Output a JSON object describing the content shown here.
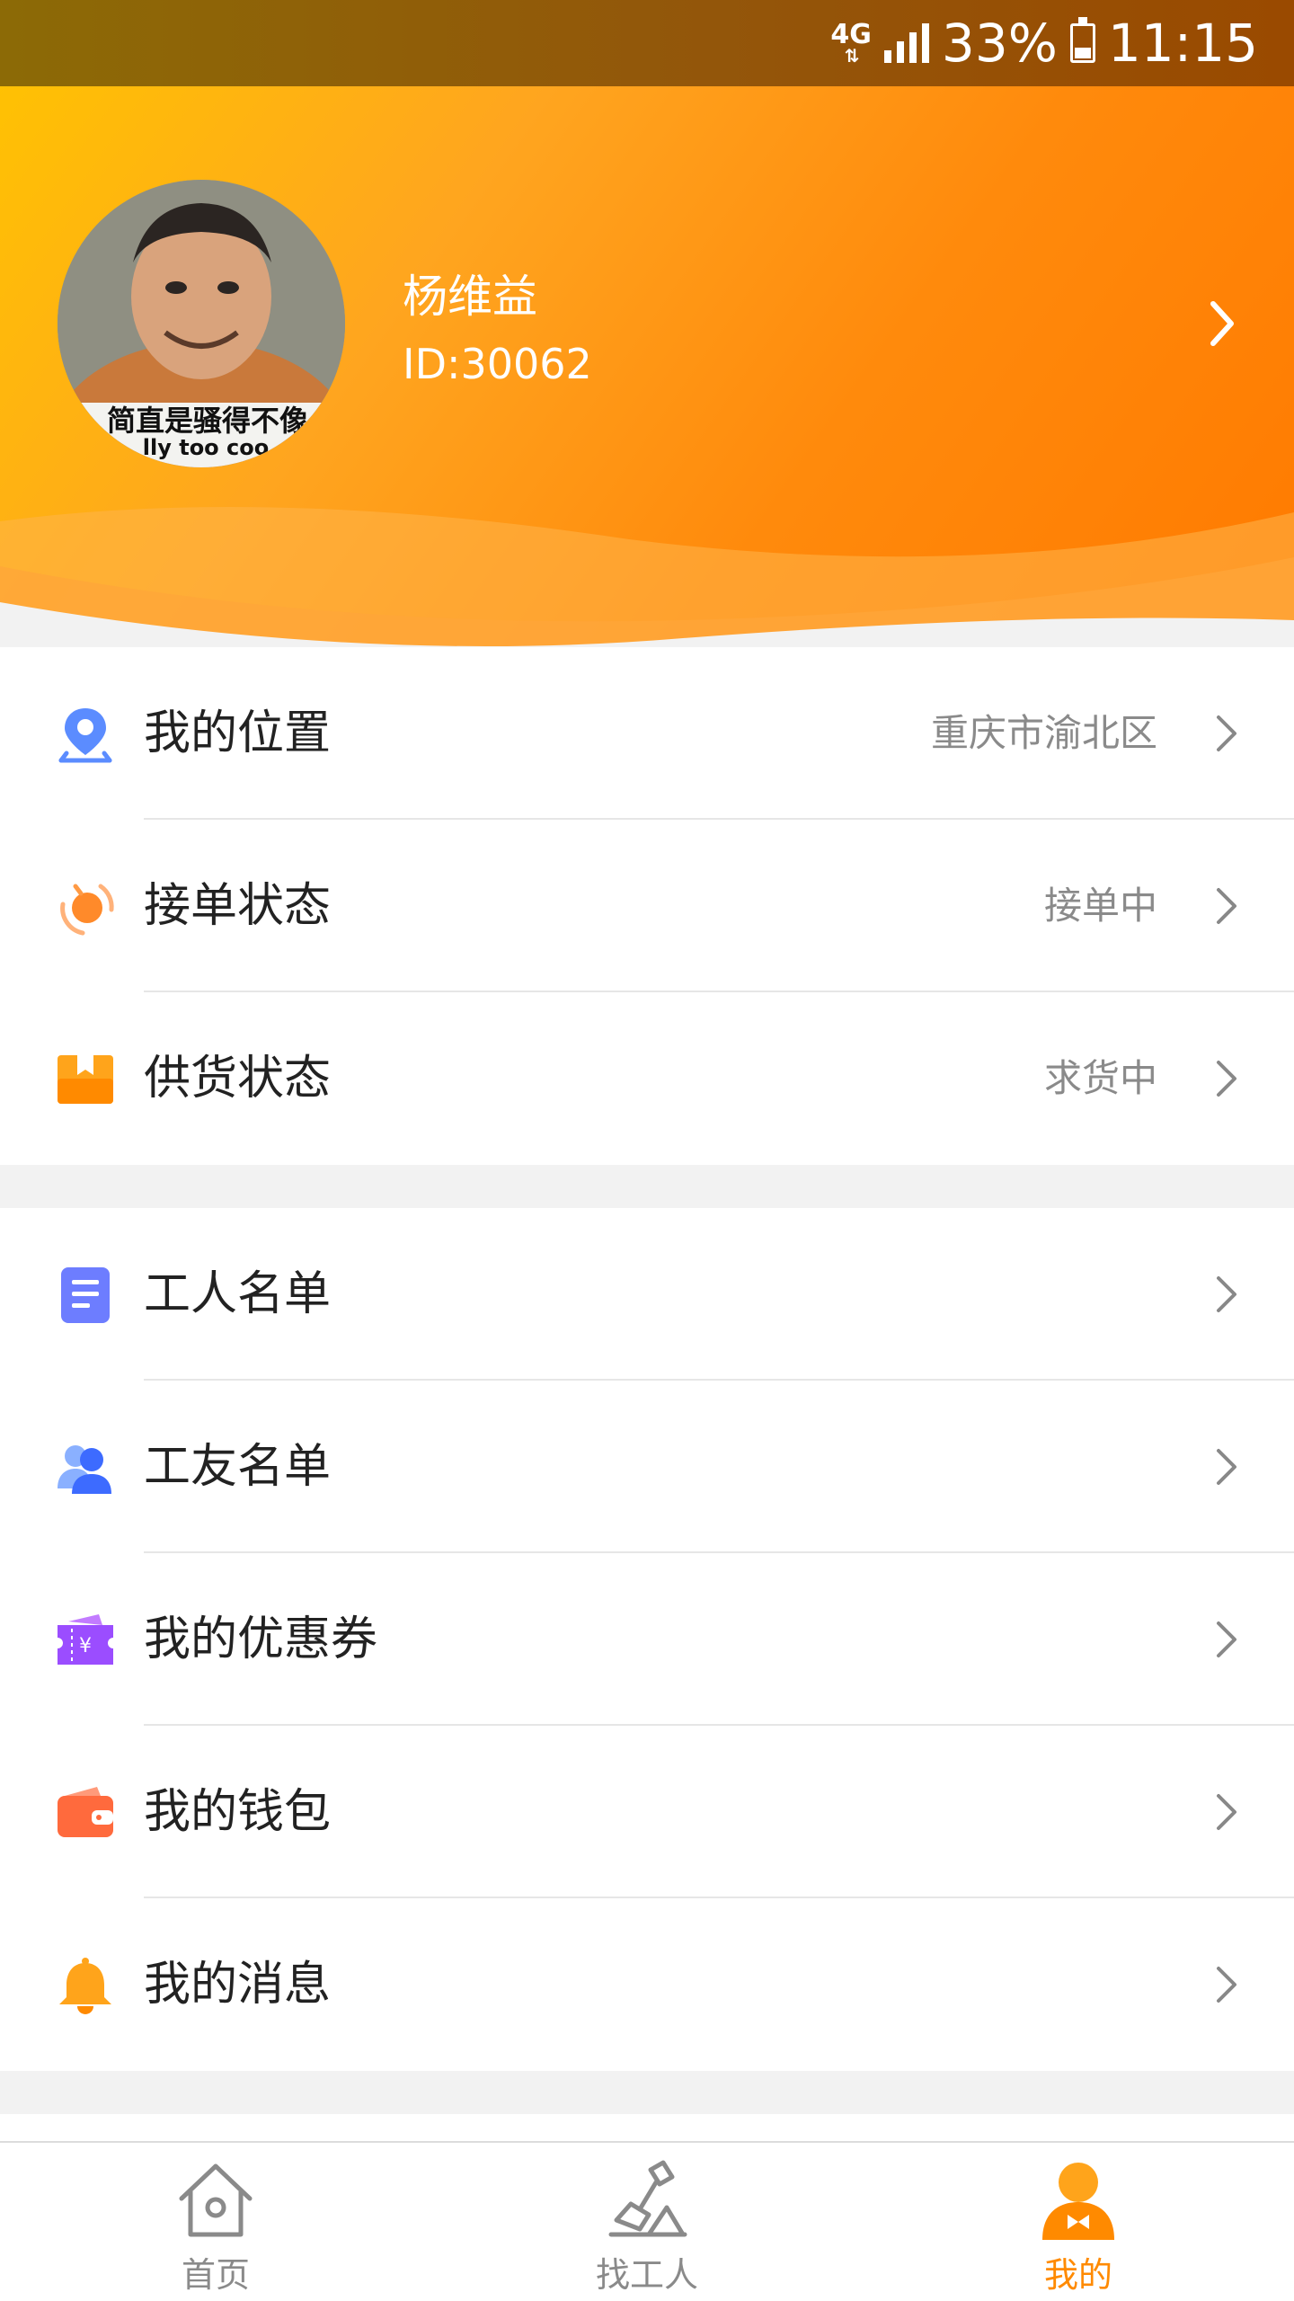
{
  "status_bar": {
    "network": "4G",
    "battery": "33%",
    "time": "11:15"
  },
  "profile": {
    "name": "杨维益",
    "id": "ID:30062",
    "avatar_caption": "简直是骚得不像",
    "avatar_caption_en": "lly too coo"
  },
  "group1": [
    {
      "icon": "location-pin-icon",
      "label": "我的位置",
      "value": "重庆市渝北区"
    },
    {
      "icon": "order-status-icon",
      "label": "接单状态",
      "value": "接单中"
    },
    {
      "icon": "supply-box-icon",
      "label": "供货状态",
      "value": "求货中"
    }
  ],
  "group2": [
    {
      "icon": "document-list-icon",
      "label": "工人名单"
    },
    {
      "icon": "users-icon",
      "label": "工友名单"
    },
    {
      "icon": "coupon-icon",
      "label": "我的优惠券"
    },
    {
      "icon": "wallet-icon",
      "label": "我的钱包"
    },
    {
      "icon": "bell-icon",
      "label": "我的消息"
    }
  ],
  "bottom_nav": [
    {
      "icon": "home-icon",
      "label": "首页",
      "active": false
    },
    {
      "icon": "find-worker-icon",
      "label": "找工人",
      "active": false
    },
    {
      "icon": "profile-icon",
      "label": "我的",
      "active": true
    }
  ],
  "colors": {
    "accent": "#ff8a00",
    "header_start": "#ffc400",
    "header_end": "#ff7a00"
  }
}
